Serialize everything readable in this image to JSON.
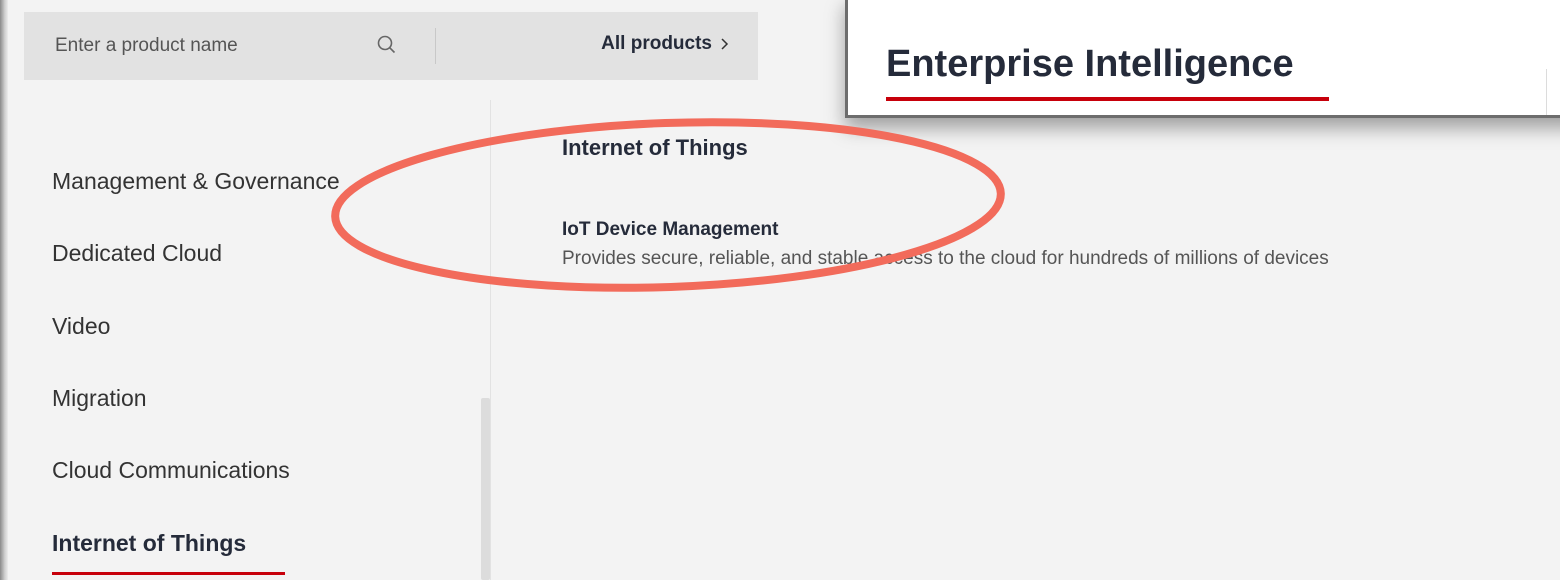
{
  "search": {
    "placeholder": "Enter a product name",
    "all_products_label": "All products"
  },
  "sidebar": {
    "items": [
      {
        "label": "Management & Governance"
      },
      {
        "label": "Dedicated Cloud"
      },
      {
        "label": "Video"
      },
      {
        "label": "Migration"
      },
      {
        "label": "Cloud Communications"
      },
      {
        "label": "Internet of Things",
        "active": true
      }
    ]
  },
  "content": {
    "heading": "Internet of Things",
    "product": {
      "title": "IoT Device Management",
      "description": "Provides secure, reliable, and stable access to the cloud for hundreds of millions of devices"
    }
  },
  "inset": {
    "title": "Enterprise Intelligence"
  },
  "colors": {
    "accent_red": "#c7000b",
    "annotation": "#f26b5b"
  }
}
